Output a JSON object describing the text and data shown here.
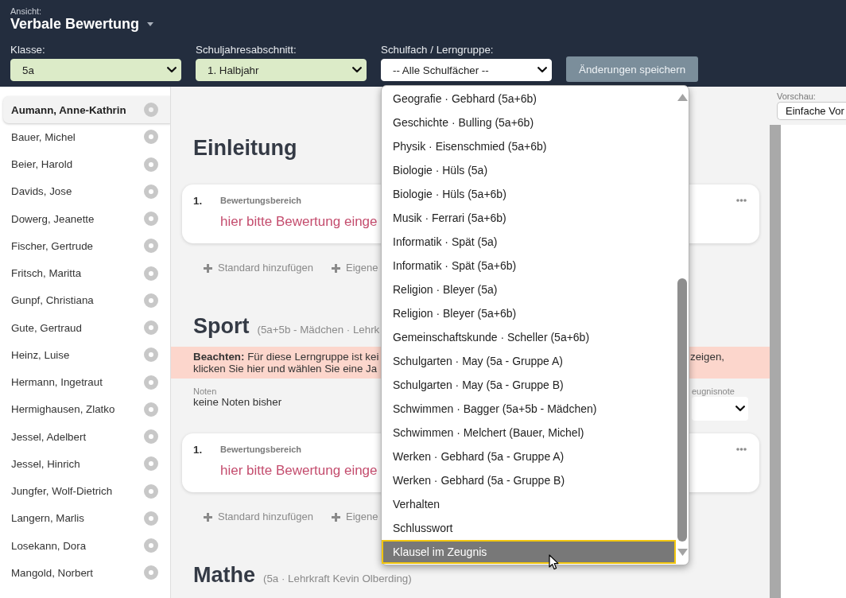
{
  "header": {
    "view_label": "Ansicht:",
    "view_title": "Verbale Bewertung",
    "filters": [
      {
        "label": "Klasse:",
        "value": "5a",
        "highlighted": true
      },
      {
        "label": "Schuljahresabschnitt:",
        "value": "1. Halbjahr",
        "highlighted": true
      },
      {
        "label": "Schulfach / Lerngruppe:",
        "value": "-- Alle Schulfächer --",
        "highlighted": false,
        "options": [
          {
            "label": "Geografie · Gebhard (5a+6b)",
            "selected": false
          },
          {
            "label": "Geschichte · Bulling (5a+6b)",
            "selected": false
          },
          {
            "label": "Physik · Eisenschmied (5a+6b)",
            "selected": false
          },
          {
            "label": "Biologie · Hüls (5a)",
            "selected": false
          },
          {
            "label": "Biologie · Hüls (5a+6b)",
            "selected": false
          },
          {
            "label": "Musik · Ferrari (5a+6b)",
            "selected": false
          },
          {
            "label": "Informatik · Spät (5a)",
            "selected": false
          },
          {
            "label": "Informatik · Spät (5a+6b)",
            "selected": false
          },
          {
            "label": "Religion · Bleyer (5a)",
            "selected": false
          },
          {
            "label": "Religion · Bleyer (5a+6b)",
            "selected": false
          },
          {
            "label": "Gemeinschaftskunde · Scheller (5a+6b)",
            "selected": false
          },
          {
            "label": "Schulgarten · May (5a - Gruppe A)",
            "selected": false
          },
          {
            "label": "Schulgarten · May (5a - Gruppe B)",
            "selected": false
          },
          {
            "label": "Schwimmen · Bagger (5a+5b - Mädchen)",
            "selected": false
          },
          {
            "label": "Schwimmen · Melchert (Bauer, Michel)",
            "selected": false
          },
          {
            "label": "Werken · Gebhard (5a - Gruppe A)",
            "selected": false
          },
          {
            "label": "Werken · Gebhard (5a - Gruppe B)",
            "selected": false
          },
          {
            "label": "Verhalten",
            "selected": false
          },
          {
            "label": "Schlusswort",
            "selected": false
          },
          {
            "label": "Klausel im Zeugnis",
            "selected": true
          }
        ]
      }
    ],
    "save_button": {
      "label": "Änderungen speichern",
      "disabled": true
    }
  },
  "students": [
    {
      "name": "Aumann, Anne-Kathrin",
      "selected": true
    },
    {
      "name": "Bauer, Michel",
      "selected": false
    },
    {
      "name": "Beier, Harold",
      "selected": false
    },
    {
      "name": "Davids, Jose",
      "selected": false
    },
    {
      "name": "Dowerg, Jeanette",
      "selected": false
    },
    {
      "name": "Fischer, Gertrude",
      "selected": false
    },
    {
      "name": "Fritsch, Maritta",
      "selected": false
    },
    {
      "name": "Gunpf, Christiana",
      "selected": false
    },
    {
      "name": "Gute, Gertraud",
      "selected": false
    },
    {
      "name": "Heinz, Luise",
      "selected": false
    },
    {
      "name": "Hermann, Ingetraut",
      "selected": false
    },
    {
      "name": "Hermighausen, Zlatko",
      "selected": false
    },
    {
      "name": "Jessel, Adelbert",
      "selected": false
    },
    {
      "name": "Jessel, Hinrich",
      "selected": false
    },
    {
      "name": "Jungfer, Wolf-Dietrich",
      "selected": false
    },
    {
      "name": "Langern, Marlis",
      "selected": false
    },
    {
      "name": "Losekann, Dora",
      "selected": false
    },
    {
      "name": "Mangold, Norbert",
      "selected": false
    }
  ],
  "sections": [
    {
      "title": "Einleitung",
      "entries": [
        {
          "number": "1.",
          "label": "Bewertungsbereich",
          "prompt": "hier bitte Bewertung einge"
        }
      ],
      "actions": [
        "Standard hinzufügen",
        "Eigene"
      ]
    },
    {
      "title": "Sport",
      "subtitle": "(5a+5b - Mädchen · Lehrk",
      "warning": {
        "lines": [
          "**Beachten:** Für diese Lerngruppe ist kei",
          "klicken Sie hier und wählen Sie eine Ja"
        ],
        "tail": "zeigen,"
      },
      "grades": {
        "label": "Noten",
        "value": "keine Noten bisher"
      },
      "report_grade": {
        "label": "eugnisnote"
      },
      "entries": [
        {
          "number": "1.",
          "label": "Bewertungsbereich",
          "prompt": "hier bitte Bewertung einge"
        }
      ],
      "actions": [
        "Standard hinzufügen",
        "Eigene"
      ]
    },
    {
      "title": "Mathe",
      "subtitle": "(5a · Lehrkraft Kevin Olberding)"
    }
  ],
  "preview": {
    "label": "Vorschau:",
    "value": "Einfache Vor"
  }
}
